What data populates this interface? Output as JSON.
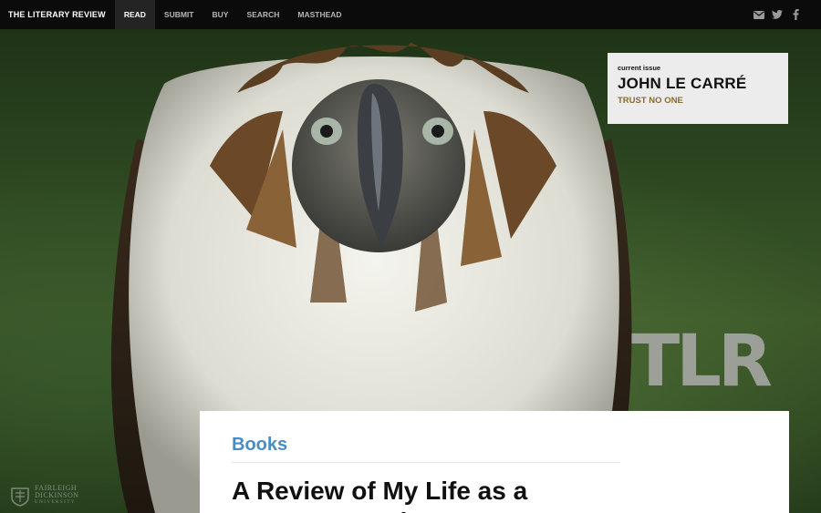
{
  "nav": {
    "brand": "THE LITERARY REVIEW",
    "items": [
      {
        "label": "READ",
        "active": true
      },
      {
        "label": "SUBMIT",
        "active": false
      },
      {
        "label": "BUY",
        "active": false
      },
      {
        "label": "SEARCH",
        "active": false
      },
      {
        "label": "MASTHEAD",
        "active": false
      }
    ],
    "icons": [
      "mail-icon",
      "twitter-icon",
      "facebook-icon"
    ]
  },
  "current_issue": {
    "label": "current issue",
    "title": "JOHN LE CARRÉ",
    "subtitle": "TRUST NO ONE"
  },
  "logo": {
    "text": "TLR"
  },
  "university": {
    "line1": "FAIRLEIGH",
    "line2": "DICKINSON",
    "line3": "UNIVERSITY"
  },
  "article": {
    "category": "Books",
    "title": "A Review of My Life as a Mercenary Writer"
  },
  "colors": {
    "nav_bg": "#0b0b0b",
    "accent_blue": "#4a8cc6",
    "issue_gold": "#8a6a2f"
  }
}
